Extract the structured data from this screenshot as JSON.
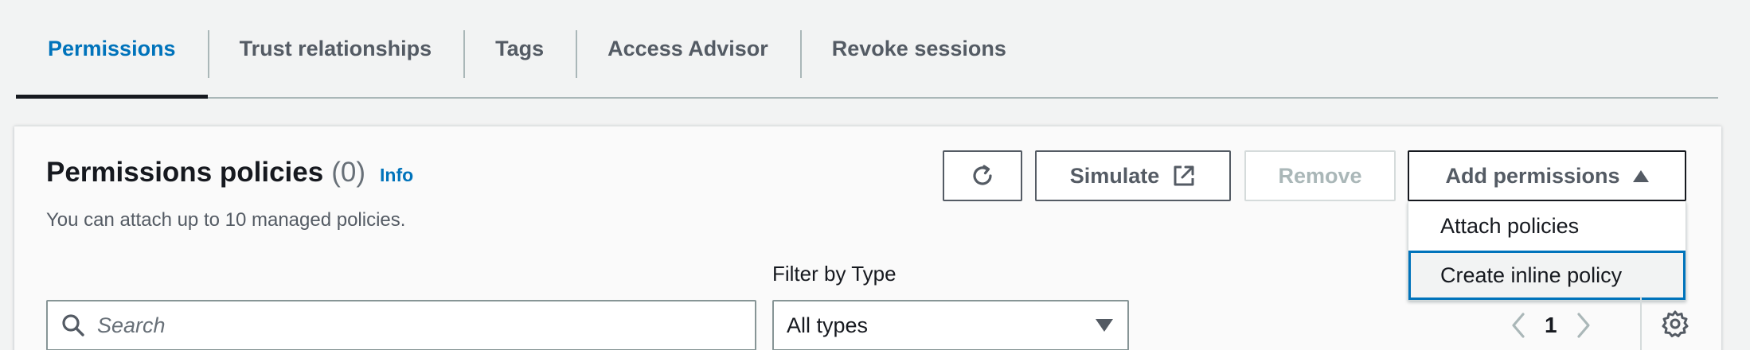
{
  "tabs": [
    {
      "label": "Permissions",
      "active": true
    },
    {
      "label": "Trust relationships",
      "active": false
    },
    {
      "label": "Tags",
      "active": false
    },
    {
      "label": "Access Advisor",
      "active": false
    },
    {
      "label": "Revoke sessions",
      "active": false
    }
  ],
  "section": {
    "title": "Permissions policies",
    "count": "(0)",
    "info_label": "Info",
    "description": "You can attach up to 10 managed policies."
  },
  "toolbar": {
    "refresh_icon": "refresh-icon",
    "simulate_label": "Simulate",
    "simulate_icon": "external-link-icon",
    "remove_label": "Remove",
    "add_permissions_label": "Add permissions",
    "add_permissions_expanded": true
  },
  "add_permissions_menu": {
    "items": [
      {
        "label": "Attach policies",
        "focused": false
      },
      {
        "label": "Create inline policy",
        "focused": true
      }
    ]
  },
  "filters": {
    "search_placeholder": "Search",
    "search_value": "",
    "type_label": "Filter by Type",
    "type_selected": "All types"
  },
  "pagination": {
    "current_page": "1"
  },
  "colors": {
    "accent": "#0073bb",
    "text_primary": "#16191f",
    "text_secondary": "#545b64",
    "disabled": "#aab7b8",
    "background": "#f2f3f3"
  }
}
